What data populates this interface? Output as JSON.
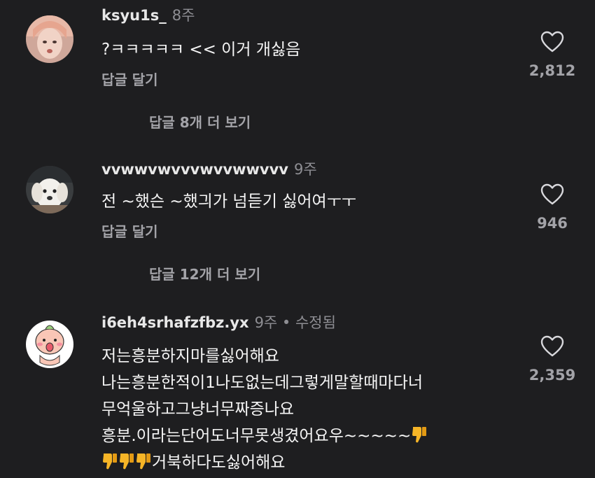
{
  "comments": [
    {
      "username": "ksyu1s_",
      "meta": "8주",
      "text_lines": [
        "?ㅋㅋㅋㅋㅋ << 이거 개싫음"
      ],
      "reply_label": "답글 달기",
      "likes": "2,812",
      "view_replies": "답글 8개 더 보기"
    },
    {
      "username": "vvwwvwvvvwvvwwvvv",
      "meta": "9주",
      "text_lines": [
        "전 ~했슨 ~했긔가 넘듣기 싫어여ㅜㅜ"
      ],
      "reply_label": "답글 달기",
      "likes": "946",
      "view_replies": "답글 12개 더 보기"
    },
    {
      "username": "i6eh4srhafzfbz.yx",
      "meta": "9주 • 수정됨",
      "text_lines": [
        "저는흥분하지마를싫어해요",
        "나는흥분한적이1나도없는데그렇게말할때마다너",
        "무억울하고그냥너무짜증나요",
        "흥분.이라는단어도너무못생겼어요우~~~~~",
        "거북하다도싫어해요"
      ],
      "likes": "2,359"
    }
  ],
  "icons": {
    "heart": "heart-outline-icon",
    "thumbs_down": "thumbs-down-emoji"
  },
  "colors": {
    "background": "#1e1e20",
    "text": "#f5f5f5",
    "secondary": "#a3a3a8",
    "emoji": "#f6b527"
  }
}
